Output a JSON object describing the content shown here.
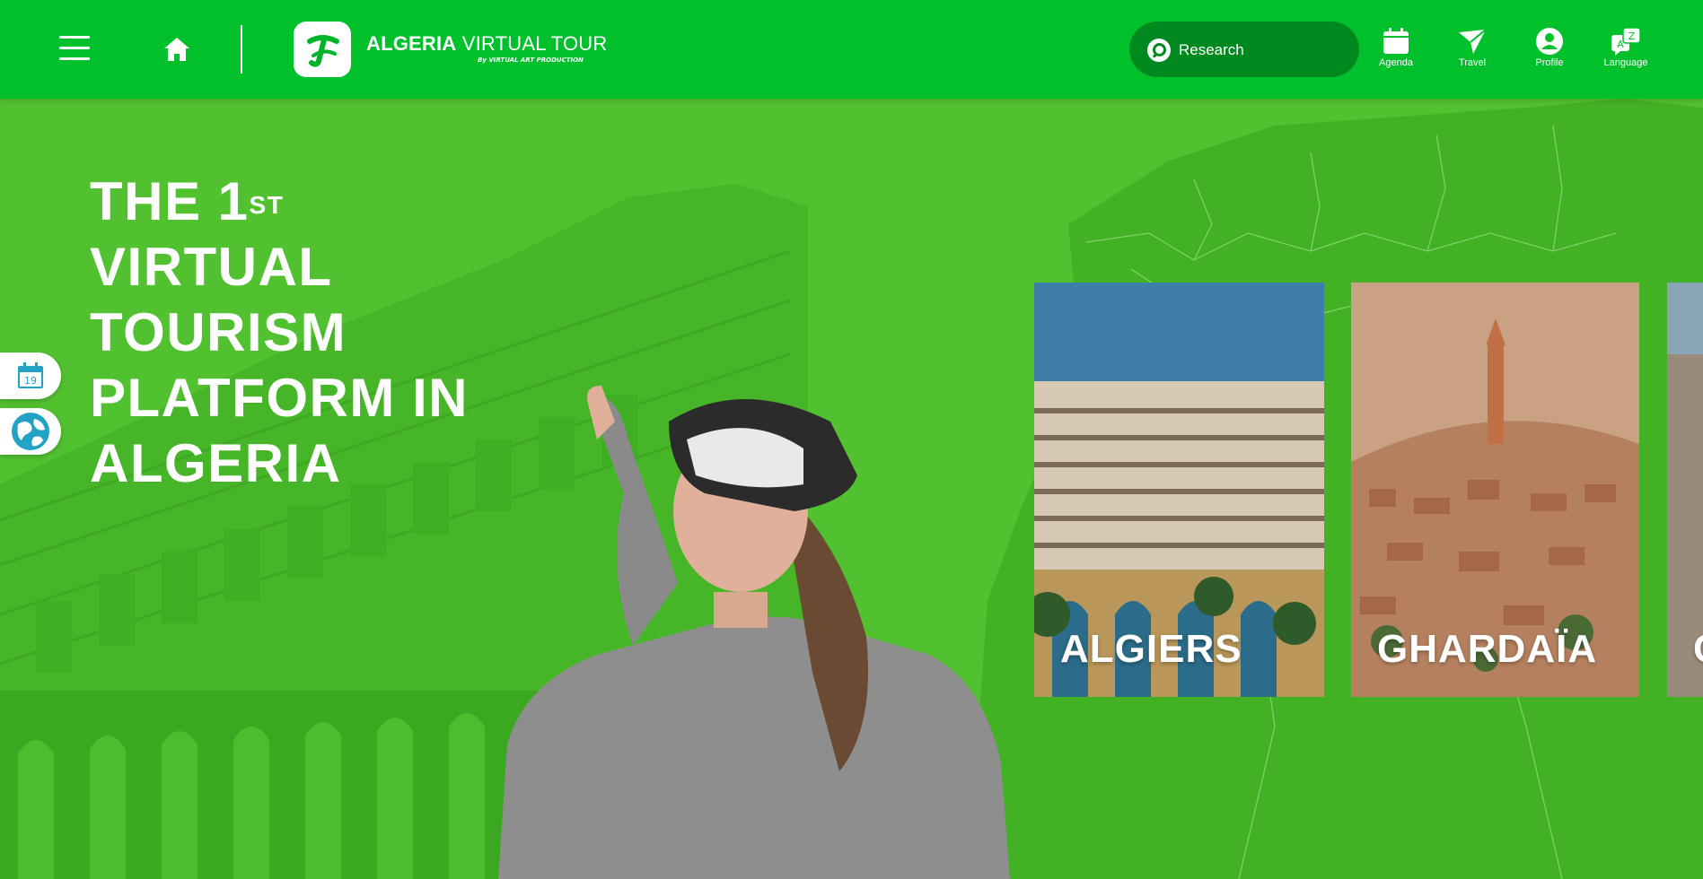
{
  "header": {
    "menu_icon": "hamburger-menu-icon",
    "home_icon": "home-icon",
    "logo": {
      "brand_bold": "ALGERIA",
      "brand_rest": " VIRTUAL TOUR",
      "byline": "By VIRTUAL ART PRODUCTION"
    },
    "search": {
      "placeholder": "Research",
      "icon": "search-icon"
    },
    "nav": [
      {
        "label": "Agenda",
        "icon": "calendar-icon"
      },
      {
        "label": "Travel",
        "icon": "paper-plane-icon"
      },
      {
        "label": "Profile",
        "icon": "user-icon"
      },
      {
        "label": "Language",
        "icon": "translate-icon"
      }
    ],
    "accent": "#00c12c"
  },
  "hero": {
    "title_line1": "THE 1",
    "title_sup": "ST",
    "title_line2": "VIRTUAL",
    "title_line3": "TOURISM",
    "title_line4": "PLATFORM IN",
    "title_line5": "ALGERIA",
    "overlay_color": "#4ec22e"
  },
  "side_tabs": [
    {
      "icon": "calendar-icon",
      "day": "19"
    },
    {
      "icon": "globe-icon"
    }
  ],
  "cities": [
    {
      "name": "ALGIERS"
    },
    {
      "name": "GHARDAÏA"
    },
    {
      "name": "C"
    }
  ]
}
